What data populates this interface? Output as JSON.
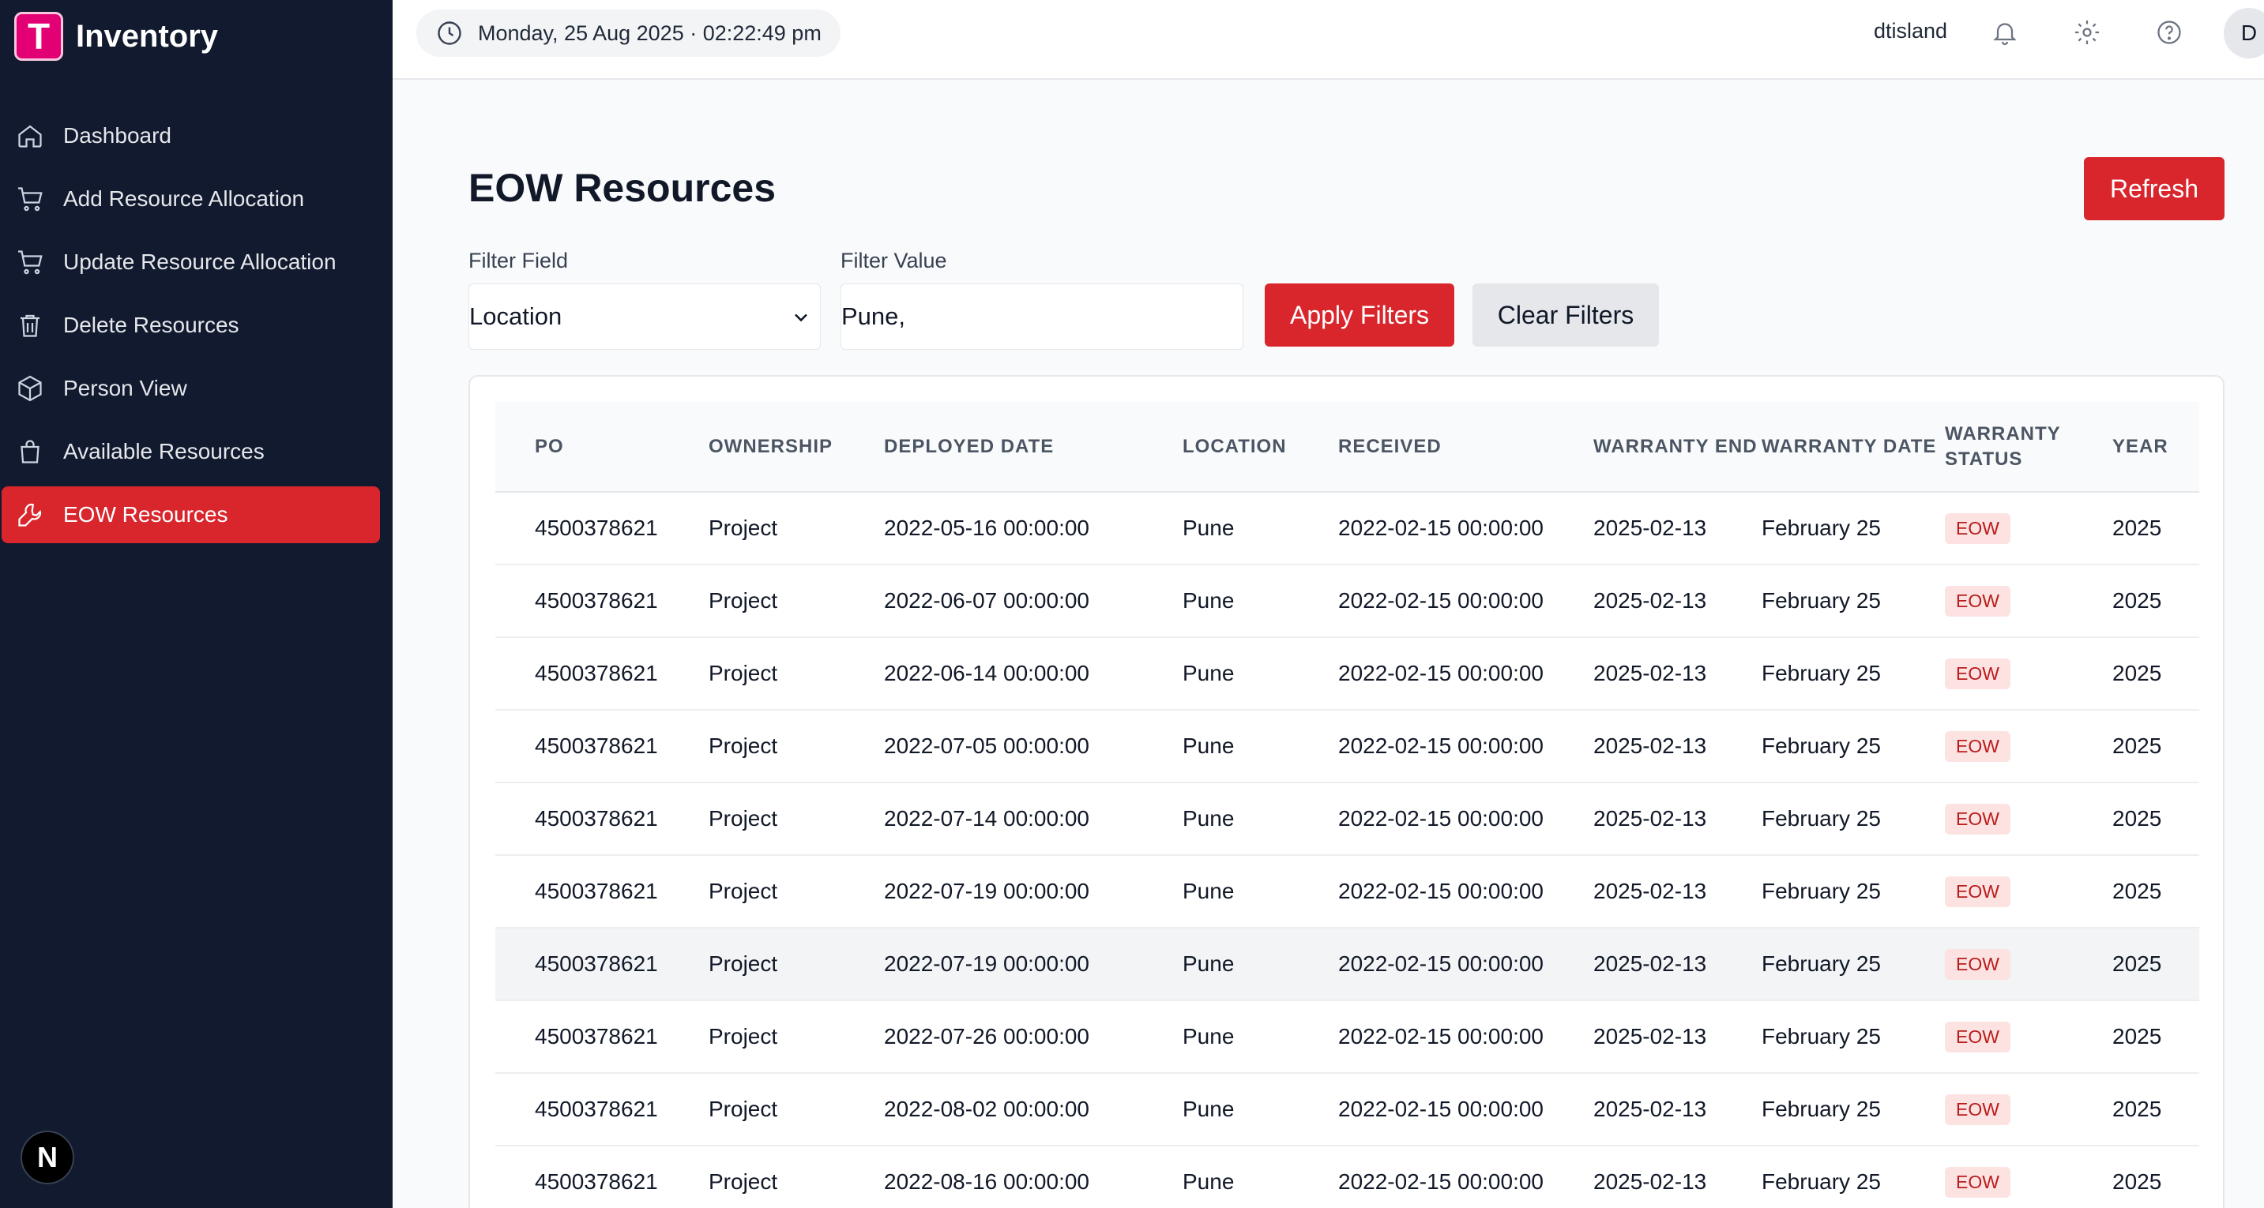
{
  "app": {
    "name": "Inventory",
    "logo_letter": "T",
    "brand_color": "#e20074"
  },
  "sidebar": {
    "items": [
      {
        "label": "Dashboard",
        "icon": "home-icon",
        "active": false
      },
      {
        "label": "Add Resource Allocation",
        "icon": "cart-icon",
        "active": false
      },
      {
        "label": "Update Resource Allocation",
        "icon": "cart-icon",
        "active": false
      },
      {
        "label": "Delete Resources",
        "icon": "trash-icon",
        "active": false
      },
      {
        "label": "Person View",
        "icon": "cube-icon",
        "active": false
      },
      {
        "label": "Available Resources",
        "icon": "bag-icon",
        "active": false
      },
      {
        "label": "EOW Resources",
        "icon": "wrench-icon",
        "active": true
      }
    ],
    "footer_badge": "N"
  },
  "header": {
    "datetime": "Monday, 25 Aug 2025 · 02:22:49 pm",
    "username": "dtisland",
    "avatar_initial": "D"
  },
  "page": {
    "title": "EOW Resources",
    "refresh_label": "Refresh"
  },
  "filters": {
    "field_label": "Filter Field",
    "field_value": "Location",
    "value_label": "Filter Value",
    "value_value": "Pune,",
    "apply_label": "Apply Filters",
    "clear_label": "Clear Filters"
  },
  "table": {
    "headers": [
      "PO",
      "OWNERSHIP",
      "DEPLOYED DATE",
      "LOCATION",
      "RECEIVED",
      "WARRANTY END",
      "WARRANTY DATE",
      "WARRANTY STATUS",
      "YEAR"
    ],
    "rows": [
      [
        "4500378621",
        "Project",
        "2022-05-16 00:00:00",
        "Pune",
        "2022-02-15 00:00:00",
        "2025-02-13",
        "February 25",
        "EOW",
        "2025"
      ],
      [
        "4500378621",
        "Project",
        "2022-06-07 00:00:00",
        "Pune",
        "2022-02-15 00:00:00",
        "2025-02-13",
        "February 25",
        "EOW",
        "2025"
      ],
      [
        "4500378621",
        "Project",
        "2022-06-14 00:00:00",
        "Pune",
        "2022-02-15 00:00:00",
        "2025-02-13",
        "February 25",
        "EOW",
        "2025"
      ],
      [
        "4500378621",
        "Project",
        "2022-07-05 00:00:00",
        "Pune",
        "2022-02-15 00:00:00",
        "2025-02-13",
        "February 25",
        "EOW",
        "2025"
      ],
      [
        "4500378621",
        "Project",
        "2022-07-14 00:00:00",
        "Pune",
        "2022-02-15 00:00:00",
        "2025-02-13",
        "February 25",
        "EOW",
        "2025"
      ],
      [
        "4500378621",
        "Project",
        "2022-07-19 00:00:00",
        "Pune",
        "2022-02-15 00:00:00",
        "2025-02-13",
        "February 25",
        "EOW",
        "2025"
      ],
      [
        "4500378621",
        "Project",
        "2022-07-19 00:00:00",
        "Pune",
        "2022-02-15 00:00:00",
        "2025-02-13",
        "February 25",
        "EOW",
        "2025"
      ],
      [
        "4500378621",
        "Project",
        "2022-07-26 00:00:00",
        "Pune",
        "2022-02-15 00:00:00",
        "2025-02-13",
        "February 25",
        "EOW",
        "2025"
      ],
      [
        "4500378621",
        "Project",
        "2022-08-02 00:00:00",
        "Pune",
        "2022-02-15 00:00:00",
        "2025-02-13",
        "February 25",
        "EOW",
        "2025"
      ],
      [
        "4500378621",
        "Project",
        "2022-08-16 00:00:00",
        "Pune",
        "2022-02-15 00:00:00",
        "2025-02-13",
        "February 25",
        "EOW",
        "2025"
      ]
    ],
    "highlighted_row": 6
  },
  "colors": {
    "sidebar_bg": "#111a2e",
    "accent": "#d9262c",
    "eow_badge_bg": "#fde2e2",
    "eow_badge_text": "#b91c1c"
  }
}
